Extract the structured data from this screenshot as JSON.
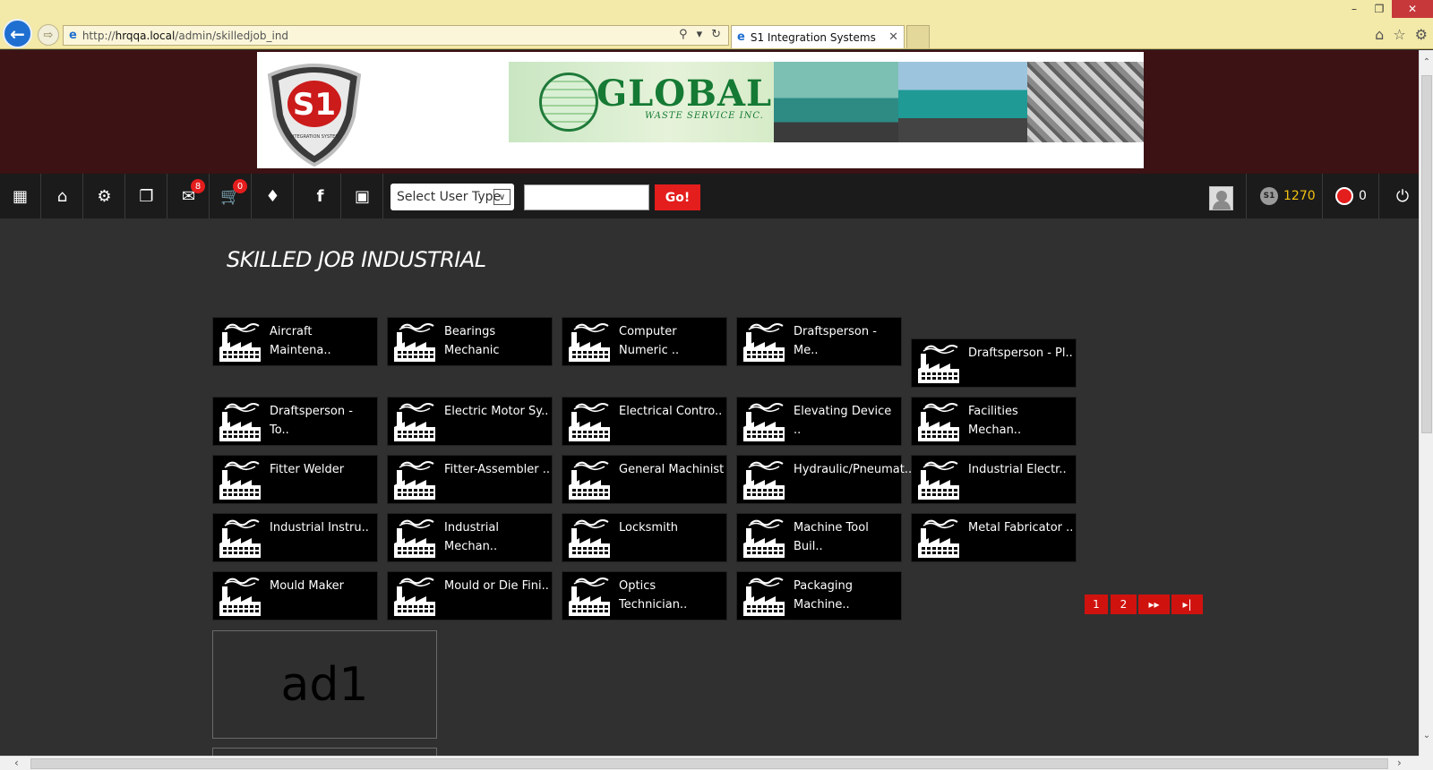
{
  "browser": {
    "url_prefix": "http://",
    "url_host": "hrqqa.local",
    "url_path": "/admin/skilledjob_ind",
    "tab_title": "S1 Integration Systems",
    "back_icon": "arrow-left-icon",
    "forward_icon": "arrow-right-icon"
  },
  "header": {
    "logo_text": "S1",
    "logo_subtext": "INTEGRATION SYSTEM",
    "banner_title": "GLOBAL",
    "banner_subtitle": "WASTE SERVICE INC."
  },
  "toolbar": {
    "messages_badge": "8",
    "cart_badge": "0",
    "user_type_select": "Select User Type",
    "go_label": "Go!",
    "points": "1270",
    "alerts": "0"
  },
  "page": {
    "title": "SKILLED JOB INDUSTRIAL"
  },
  "jobs": [
    "Aircraft Maintena..",
    "Bearings Mechanic",
    "Computer Numeric ..",
    "Draftsperson - Me..",
    "Draftsperson - Pl..",
    "Draftsperson - To..",
    "Electric Motor Sy..",
    "Electrical Contro..",
    "Elevating Device ..",
    "Facilities Mechan..",
    "Fitter Welder",
    "Fitter-Assembler ..",
    "General Machinist",
    "Hydraulic/Pneumat..",
    "Industrial Electr..",
    "Industrial Instru..",
    "Industrial Mechan..",
    "Locksmith",
    "Machine Tool Buil..",
    "Metal Fabricator ..",
    "Mould Maker",
    "Mould or Die Fini..",
    "Optics Technician..",
    "Packaging Machine.."
  ],
  "pager": {
    "pages": [
      "1",
      "2"
    ],
    "next_icon": "fast-forward-icon",
    "last_icon": "skip-to-end-icon",
    "next_label": "▸▸",
    "last_label": "▸|"
  },
  "ad": {
    "label": "ad1"
  },
  "colors": {
    "accent_red": "#e41d1d",
    "header_bg": "#3c1214",
    "toolbar_bg": "#1b1b1b",
    "content_bg": "#303030",
    "points_color": "#f2c312"
  }
}
